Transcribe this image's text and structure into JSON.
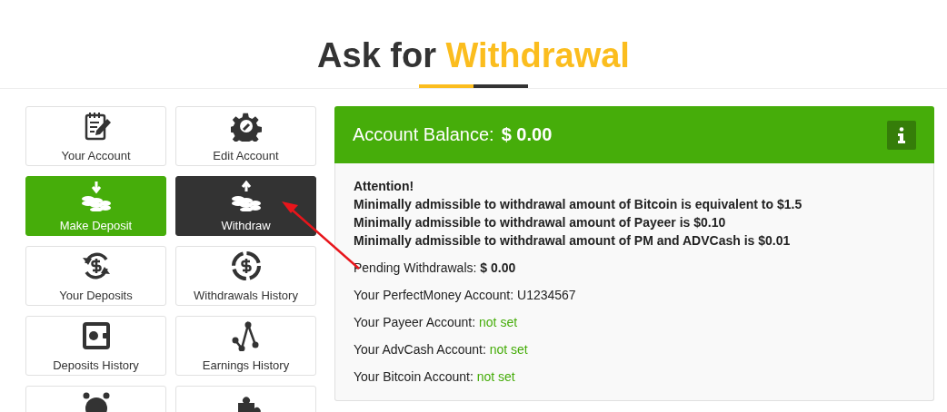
{
  "heading": {
    "prefix": "Ask for",
    "highlight": "Withdrawal"
  },
  "menu": [
    {
      "label": "Your Account",
      "kind": "plain"
    },
    {
      "label": "Edit Account",
      "kind": "plain"
    },
    {
      "label": "Make Deposit",
      "kind": "green"
    },
    {
      "label": "Withdraw",
      "kind": "dark"
    },
    {
      "label": "Your Deposits",
      "kind": "plain"
    },
    {
      "label": "Withdrawals History",
      "kind": "plain"
    },
    {
      "label": "Deposits History",
      "kind": "plain"
    },
    {
      "label": "Earnings History",
      "kind": "plain"
    },
    {
      "kind": "plain"
    },
    {
      "kind": "plain"
    }
  ],
  "balance": {
    "label": "Account Balance:",
    "amount": "$ 0.00"
  },
  "notice": {
    "title": "Attention!",
    "lines": [
      "Minimally admissible to withdrawal amount of Bitcoin is equivalent to $1.5",
      "Minimally admissible to withdrawal amount of Payeer is $0.10",
      "Minimally admissible to withdrawal amount of PM and ADVCash is $0.01"
    ]
  },
  "details": [
    {
      "label": "Pending Withdrawals:",
      "value": "$ 0.00",
      "kind": "amount"
    },
    {
      "label": "Your PerfectMoney Account:",
      "value": "U1234567",
      "kind": "plain"
    },
    {
      "label": "Your Payeer Account:",
      "value": "not set",
      "kind": "missing"
    },
    {
      "label": "Your AdvCash Account:",
      "value": "not set",
      "kind": "missing"
    },
    {
      "label": "Your Bitcoin Account:",
      "value": "not set",
      "kind": "missing"
    }
  ]
}
